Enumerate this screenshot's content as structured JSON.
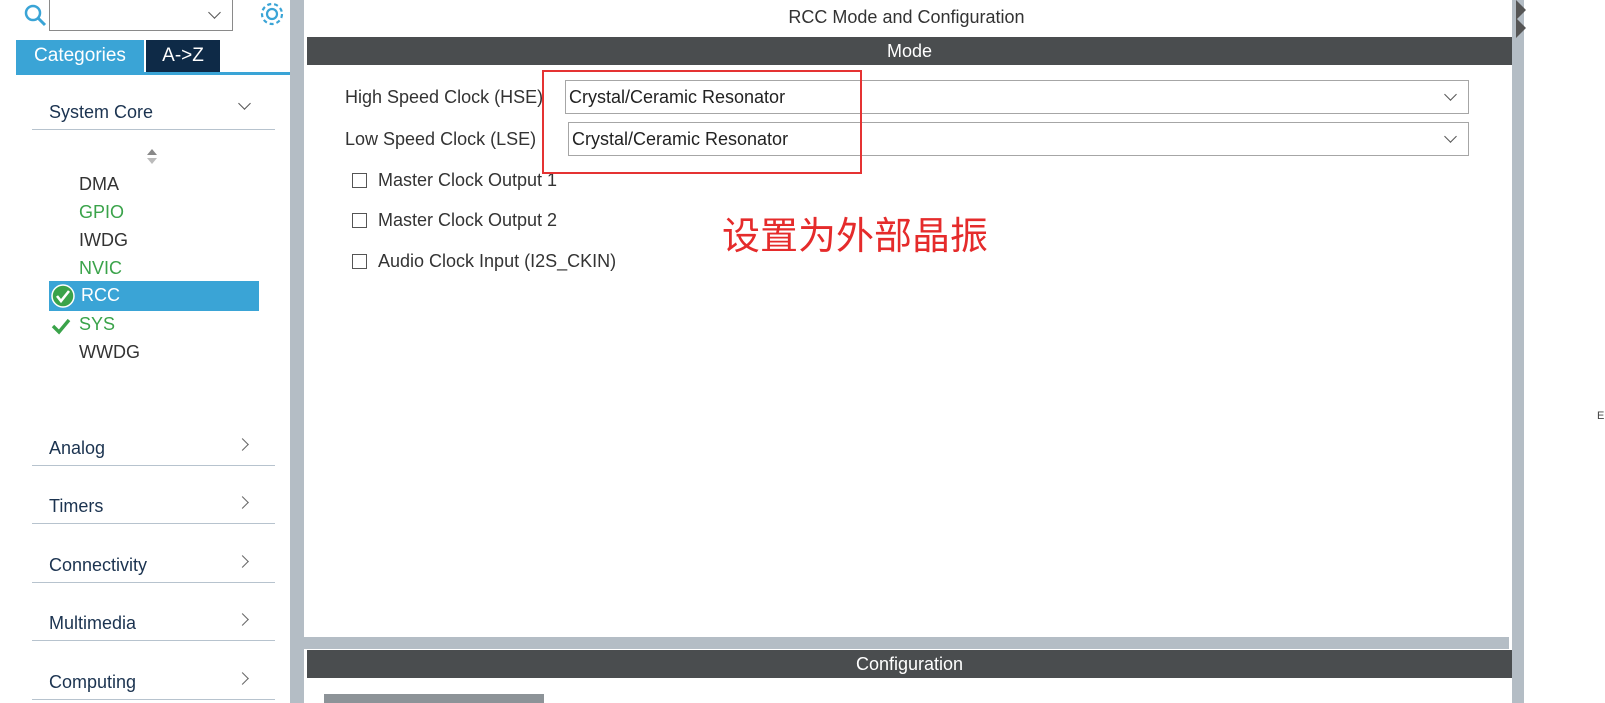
{
  "sidebar": {
    "search": {
      "value": "",
      "placeholder": ""
    },
    "tabs": [
      {
        "label": "Categories",
        "active": true
      },
      {
        "label": "A->Z",
        "active": false
      }
    ],
    "system_core": {
      "label": "System Core",
      "items": [
        {
          "label": "DMA",
          "color": "#333333",
          "status": "none"
        },
        {
          "label": "GPIO",
          "color": "#3aa34a",
          "status": "none"
        },
        {
          "label": "IWDG",
          "color": "#333333",
          "status": "none"
        },
        {
          "label": "NVIC",
          "color": "#3aa34a",
          "status": "none"
        },
        {
          "label": "RCC",
          "color": "#ffffff",
          "status": "selected-check"
        },
        {
          "label": "SYS",
          "color": "#3aa34a",
          "status": "check"
        },
        {
          "label": "WWDG",
          "color": "#333333",
          "status": "none"
        }
      ]
    },
    "categories": [
      "Analog",
      "Timers",
      "Connectivity",
      "Multimedia",
      "Computing"
    ]
  },
  "main": {
    "title": "RCC Mode and Configuration",
    "mode_header": "Mode",
    "hse": {
      "label": "High Speed Clock (HSE)",
      "value": "Crystal/Ceramic Resonator"
    },
    "lse": {
      "label": "Low Speed Clock (LSE)",
      "value": "Crystal/Ceramic Resonator"
    },
    "checkboxes": [
      {
        "label": "Master Clock Output 1",
        "checked": false
      },
      {
        "label": "Master Clock Output 2",
        "checked": false
      },
      {
        "label": "Audio Clock Input (I2S_CKIN)",
        "checked": false
      }
    ],
    "annotation": "设置为外部晶振",
    "config_header": "Configuration"
  },
  "edge_letter": "E",
  "colors": {
    "accent": "#3aa4d6",
    "selected": "#3aa4d6",
    "green": "#3aa34a",
    "annotation": "#e52b2b",
    "header": "#4a4d4f"
  }
}
